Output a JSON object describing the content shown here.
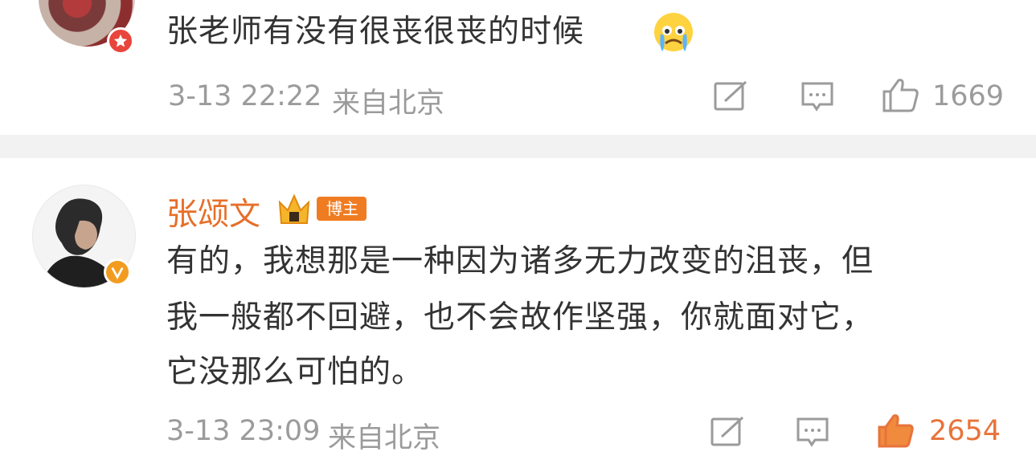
{
  "comment1": {
    "text": "张老师有没有很丧很丧的时候",
    "time": "3-13 22:22",
    "location": "来自北京",
    "like_count": "1669",
    "emoji_icon": "crying-face-icon"
  },
  "comment2": {
    "username": "张颂文",
    "tag": "博主",
    "lines": [
      "有的，我想那是一种因为诸多无力改变的沮丧，但",
      "我一般都不回避，也不会故作坚强，你就面对它，",
      "它没那么可怕的。"
    ],
    "time": "3-13 23:09",
    "location": "来自北京",
    "like_count": "2654"
  },
  "colors": {
    "accent": "#e8733b",
    "meta": "#9b9b9b",
    "text": "#333333",
    "divider": "#f2f2f2"
  }
}
